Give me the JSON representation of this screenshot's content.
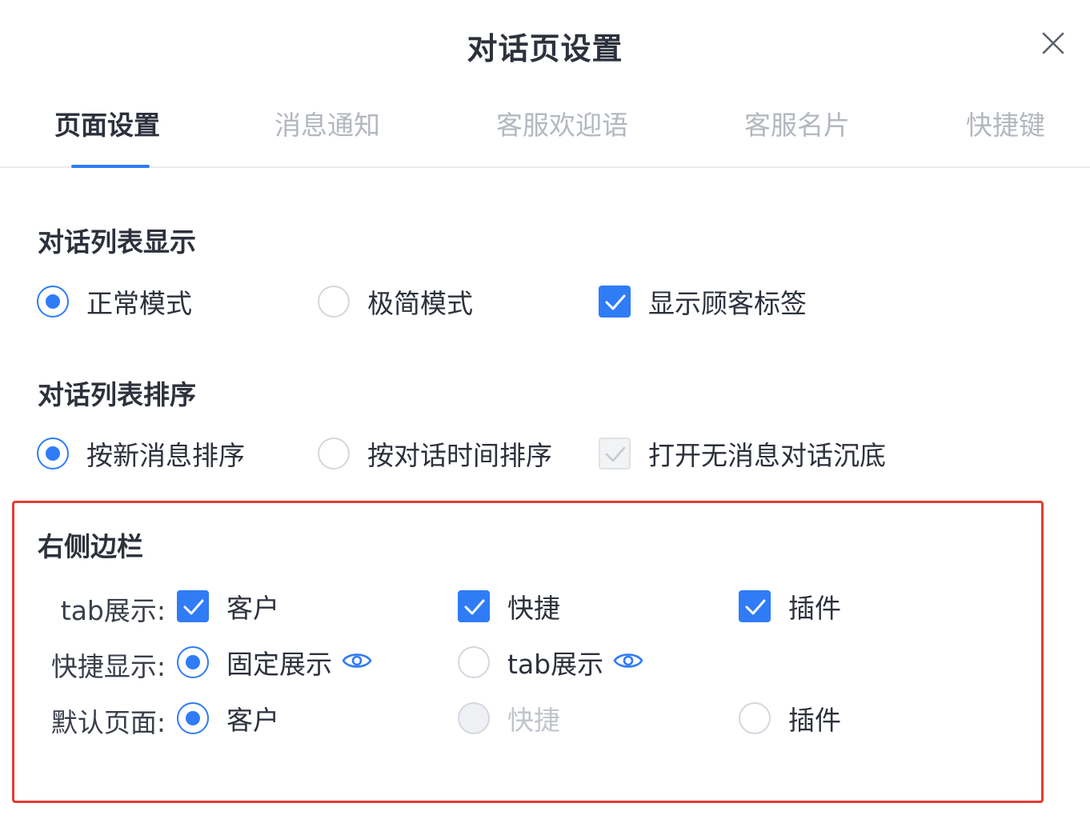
{
  "dialog": {
    "title": "对话页设置"
  },
  "tabs": [
    {
      "label": "页面设置",
      "active": true
    },
    {
      "label": "消息通知",
      "active": false
    },
    {
      "label": "客服欢迎语",
      "active": false
    },
    {
      "label": "客服名片",
      "active": false
    },
    {
      "label": "快捷键",
      "active": false
    }
  ],
  "list_display": {
    "title": "对话列表显示",
    "options": [
      {
        "label": "正常模式",
        "type": "radio",
        "checked": true
      },
      {
        "label": "极简模式",
        "type": "radio",
        "checked": false
      },
      {
        "label": "显示顾客标签",
        "type": "checkbox",
        "checked": true
      }
    ]
  },
  "list_sort": {
    "title": "对话列表排序",
    "options": [
      {
        "label": "按新消息排序",
        "type": "radio",
        "checked": true
      },
      {
        "label": "按对话时间排序",
        "type": "radio",
        "checked": false
      },
      {
        "label": "打开无消息对话沉底",
        "type": "checkbox",
        "checked": true,
        "disabled": true
      }
    ]
  },
  "sidebar": {
    "title": "右侧边栏",
    "tab_display": {
      "label": "tab展示:",
      "options": [
        {
          "label": "客户",
          "checked": true
        },
        {
          "label": "快捷",
          "checked": true
        },
        {
          "label": "插件",
          "checked": true
        }
      ]
    },
    "quick_display": {
      "label": "快捷显示:",
      "options": [
        {
          "label": "固定展示",
          "checked": true,
          "icon": "eye-icon"
        },
        {
          "label": "tab展示",
          "checked": false,
          "icon": "eye-icon"
        }
      ]
    },
    "default_page": {
      "label": "默认页面:",
      "options": [
        {
          "label": "客户",
          "checked": true
        },
        {
          "label": "快捷",
          "checked": false,
          "disabled": true
        },
        {
          "label": "插件",
          "checked": false
        }
      ]
    }
  },
  "colors": {
    "primary": "#2f7cf6",
    "highlight_border": "#e43d33",
    "muted_text": "#b3b7bf"
  }
}
